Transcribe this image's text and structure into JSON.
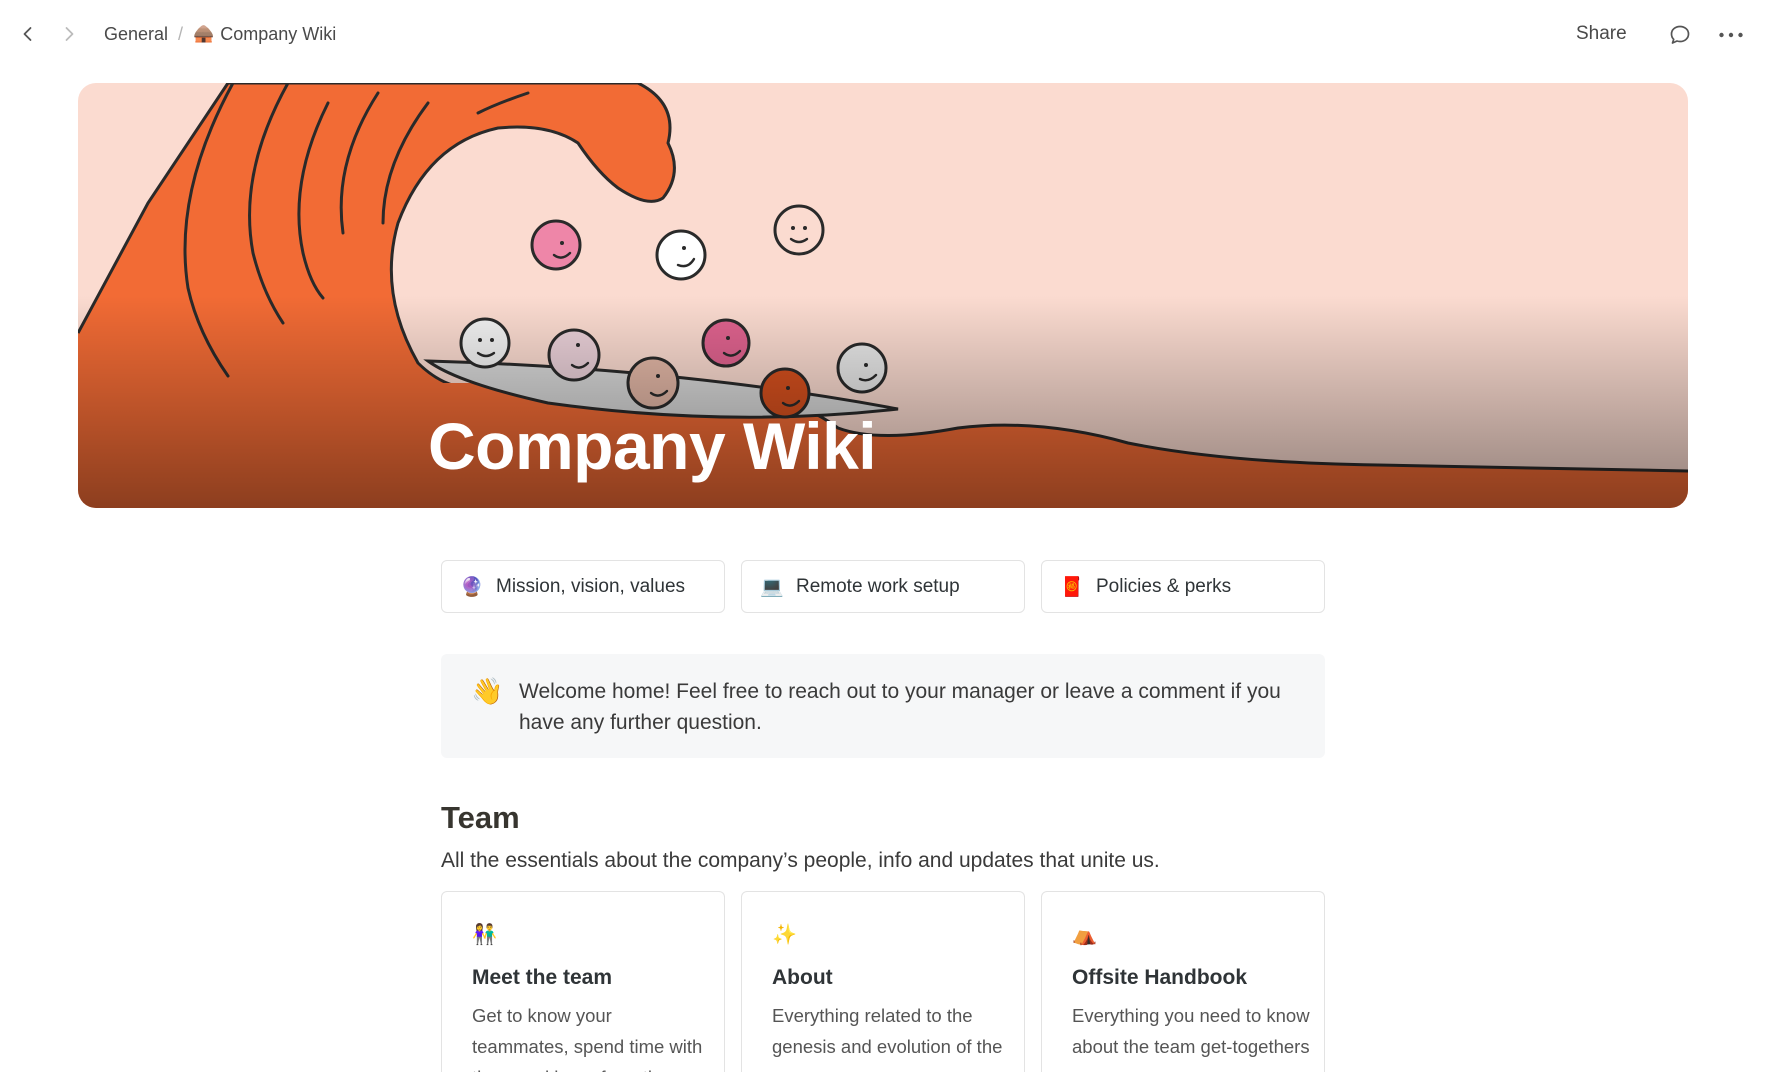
{
  "topbar": {
    "breadcrumb": [
      {
        "label": "General"
      },
      {
        "emoji": "🛖",
        "label": "Company Wiki"
      }
    ],
    "separator": "/",
    "share_label": "Share"
  },
  "cover": {
    "title": "Company Wiki"
  },
  "quicklinks": [
    {
      "emoji": "🔮",
      "label": "Mission, vision, values"
    },
    {
      "emoji": "💻",
      "label": "Remote work setup"
    },
    {
      "emoji": "🧧",
      "label": "Policies & perks"
    }
  ],
  "callout": {
    "emoji": "👋",
    "text": "Welcome home! Feel free to reach out to your manager or leave a comment if you have any further question."
  },
  "team": {
    "heading": "Team",
    "description": "All the essentials about the company’s people, info and updates that unite us.",
    "cards": [
      {
        "emoji": "👫",
        "title": "Meet the team",
        "text": "Get to know your teammates, spend time with them and learn from them"
      },
      {
        "emoji": "✨",
        "title": "About",
        "text": "Everything related to the genesis and evolution of the company"
      },
      {
        "emoji": "⛺",
        "title": "Offsite Handbook",
        "text": "Everything you need to know about the team get-togethers"
      }
    ]
  },
  "colors": {
    "wave": "#f26b35",
    "cover_bg": "#fbdbd0",
    "callout_bg": "#f6f7f8"
  }
}
